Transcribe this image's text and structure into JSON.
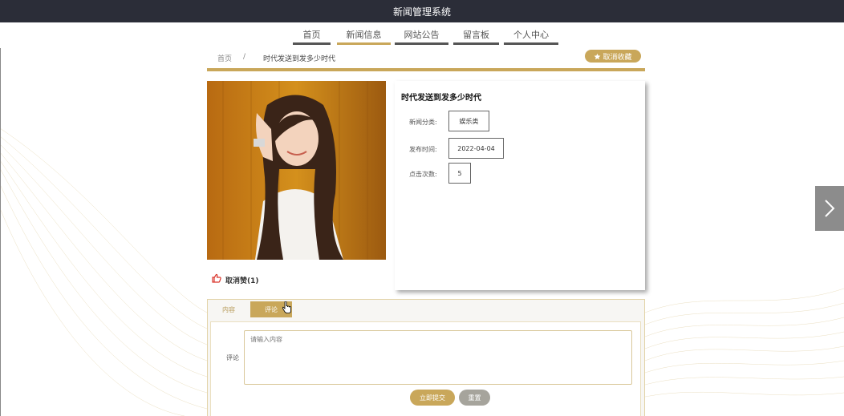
{
  "app": {
    "title": "新闻管理系统"
  },
  "nav": {
    "items": [
      {
        "label": "首页",
        "active": false
      },
      {
        "label": "新闻信息",
        "active": true
      },
      {
        "label": "网站公告",
        "active": false
      },
      {
        "label": "留言板",
        "active": false
      },
      {
        "label": "个人中心",
        "active": false
      }
    ]
  },
  "breadcrumb": {
    "home": "首页",
    "separator": "/",
    "current": "时代发送到发多少时代"
  },
  "favorite_button": {
    "label": "取消收藏",
    "icon": "star-icon"
  },
  "news": {
    "title": "时代发送到发多少时代",
    "fields": [
      {
        "label": "新闻分类:",
        "value": "娱乐类"
      },
      {
        "label": "发布时间:",
        "value": "2022-04-04"
      },
      {
        "label": "点击次数:",
        "value": "5"
      }
    ],
    "like": {
      "label": "取消赞(1)",
      "icon": "thumbs-up-icon"
    }
  },
  "tabs": [
    {
      "label": "内容",
      "active": false
    },
    {
      "label": "评论",
      "active": true
    }
  ],
  "comment": {
    "label": "评论",
    "placeholder": "请输入内容",
    "submit_label": "立即提交",
    "reset_label": "重置"
  },
  "colors": {
    "accent": "#c9a75a",
    "topbar": "#2b2d38",
    "nav_underline": "#555555",
    "reset": "#a6a49c"
  },
  "carousel": {
    "next_icon": "chevron-right-icon"
  }
}
